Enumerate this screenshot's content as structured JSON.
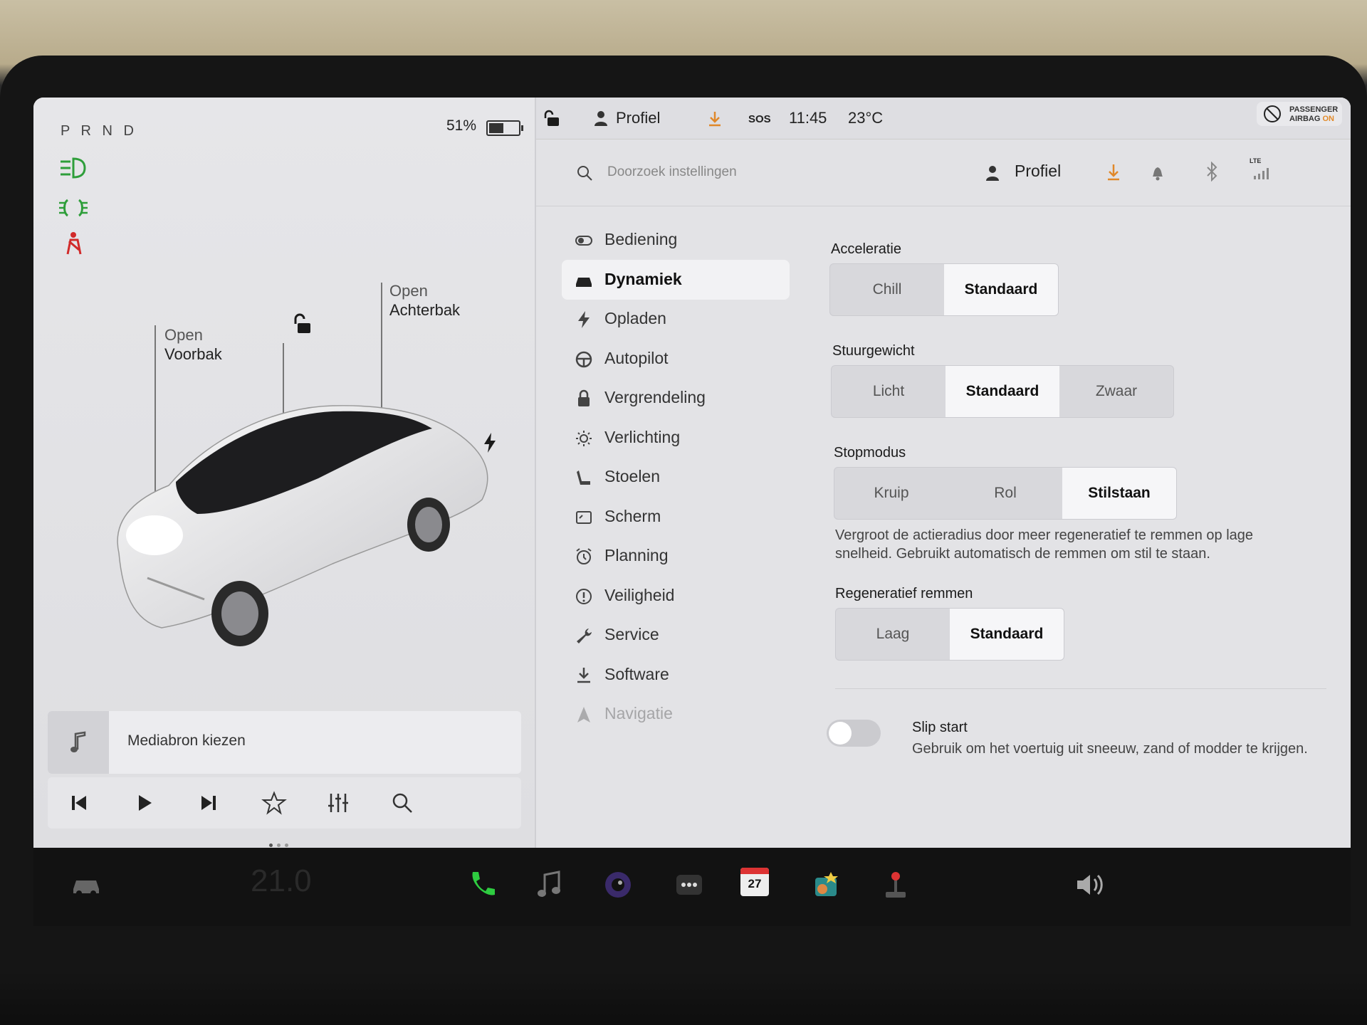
{
  "left_panel": {
    "gear": "P R N D",
    "battery_percent": "51%",
    "battery_level": 0.51,
    "frunk": {
      "action": "Open",
      "name": "Voorbak"
    },
    "trunk": {
      "action": "Open",
      "name": "Achterbak"
    },
    "media": {
      "label": "Mediabron kiezen"
    },
    "page_dots": 3,
    "active_dot": 0
  },
  "status_bar": {
    "profile": "Profiel",
    "sos": "SOS",
    "time": "11:45",
    "temperature": "23°C",
    "airbag_line1": "PASSENGER",
    "airbag_line2": "AIRBAG",
    "airbag_state": "ON"
  },
  "header": {
    "search_placeholder": "Doorzoek instellingen",
    "profile": "Profiel",
    "lte": "LTE"
  },
  "nav": {
    "items": [
      {
        "label": "Bediening",
        "icon": "toggle-icon"
      },
      {
        "label": "Dynamiek",
        "icon": "car-icon"
      },
      {
        "label": "Opladen",
        "icon": "bolt-icon"
      },
      {
        "label": "Autopilot",
        "icon": "steering-wheel-icon"
      },
      {
        "label": "Vergrendeling",
        "icon": "lock-icon"
      },
      {
        "label": "Verlichting",
        "icon": "sun-icon"
      },
      {
        "label": "Stoelen",
        "icon": "seat-icon"
      },
      {
        "label": "Scherm",
        "icon": "display-icon"
      },
      {
        "label": "Planning",
        "icon": "alarm-icon"
      },
      {
        "label": "Veiligheid",
        "icon": "alert-icon"
      },
      {
        "label": "Service",
        "icon": "wrench-icon"
      },
      {
        "label": "Software",
        "icon": "download-icon"
      },
      {
        "label": "Navigatie",
        "icon": "navigation-icon"
      }
    ],
    "active_index": 1
  },
  "settings": {
    "acceleratie": {
      "title": "Acceleratie",
      "options": [
        "Chill",
        "Standaard"
      ],
      "selected": 1
    },
    "stuurgewicht": {
      "title": "Stuurgewicht",
      "options": [
        "Licht",
        "Standaard",
        "Zwaar"
      ],
      "selected": 1
    },
    "stopmodus": {
      "title": "Stopmodus",
      "options": [
        "Kruip",
        "Rol",
        "Stilstaan"
      ],
      "selected": 2,
      "description": "Vergroot de actieradius door meer regeneratief te remmen op lage snelheid. Gebruikt automatisch de remmen om stil te staan."
    },
    "regen": {
      "title": "Regeneratief remmen",
      "options": [
        "Laag",
        "Standaard"
      ],
      "selected": 1
    },
    "slip_start": {
      "title": "Slip start",
      "description": "Gebruik om het voertuig uit sneeuw, zand of modder te krijgen.",
      "enabled": false
    }
  },
  "taskbar": {
    "temperature": "21.0",
    "calendar_day": "27",
    "colors": {
      "phone": "#2ecc40",
      "calendar": "#d33333"
    }
  }
}
